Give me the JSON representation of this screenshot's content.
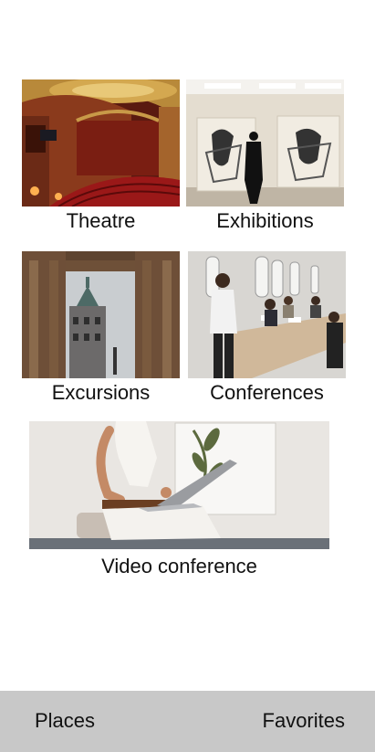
{
  "categories": [
    {
      "id": "theatre",
      "label": "Theatre",
      "image": "theatre-image"
    },
    {
      "id": "exhibitions",
      "label": "Exhibitions",
      "image": "gallery-image"
    },
    {
      "id": "excursions",
      "label": "Excursions",
      "image": "city-arch-image"
    },
    {
      "id": "conferences",
      "label": "Conferences",
      "image": "meeting-room-image"
    },
    {
      "id": "video",
      "label": "Video conference",
      "image": "laptop-person-image"
    }
  ],
  "bottom_nav": {
    "places_label": "Places",
    "favorites_label": "Favorites",
    "background": "#c8c8c8"
  }
}
